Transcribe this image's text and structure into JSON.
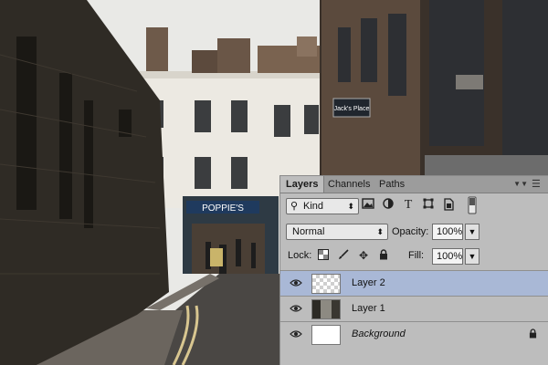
{
  "photo": {
    "sign_left": "POPPIE'S",
    "sign_right": "Jack's Place"
  },
  "panel": {
    "tabs": [
      "Layers",
      "Channels",
      "Paths"
    ],
    "active_tab": "Layers",
    "kind_label": "Kind",
    "blend_mode": "Normal",
    "opacity_label": "Opacity:",
    "opacity_value": "100%",
    "lock_label": "Lock:",
    "fill_label": "Fill:",
    "fill_value": "100%",
    "layers": [
      {
        "name": "Layer 2",
        "selected": true,
        "visible": true
      },
      {
        "name": "Layer 1",
        "selected": false,
        "visible": true
      },
      {
        "name": "Background",
        "selected": false,
        "visible": true,
        "locked": true
      }
    ]
  },
  "colors": {
    "panel_bg": "#bdbdbd",
    "selected_layer": "#a9b8d6",
    "brick_dark": "#2f2b25",
    "sky": "#e9e9e6"
  },
  "icons": [
    "search-icon",
    "image-filter-icon",
    "adjustment-filter-icon",
    "type-filter-icon",
    "shape-filter-icon",
    "smart-object-filter-icon",
    "filter-toggle-icon",
    "eye-icon",
    "lock-icon",
    "transparent-pixels-lock-icon",
    "brush-lock-icon",
    "move-lock-icon",
    "panel-menu-icon"
  ]
}
